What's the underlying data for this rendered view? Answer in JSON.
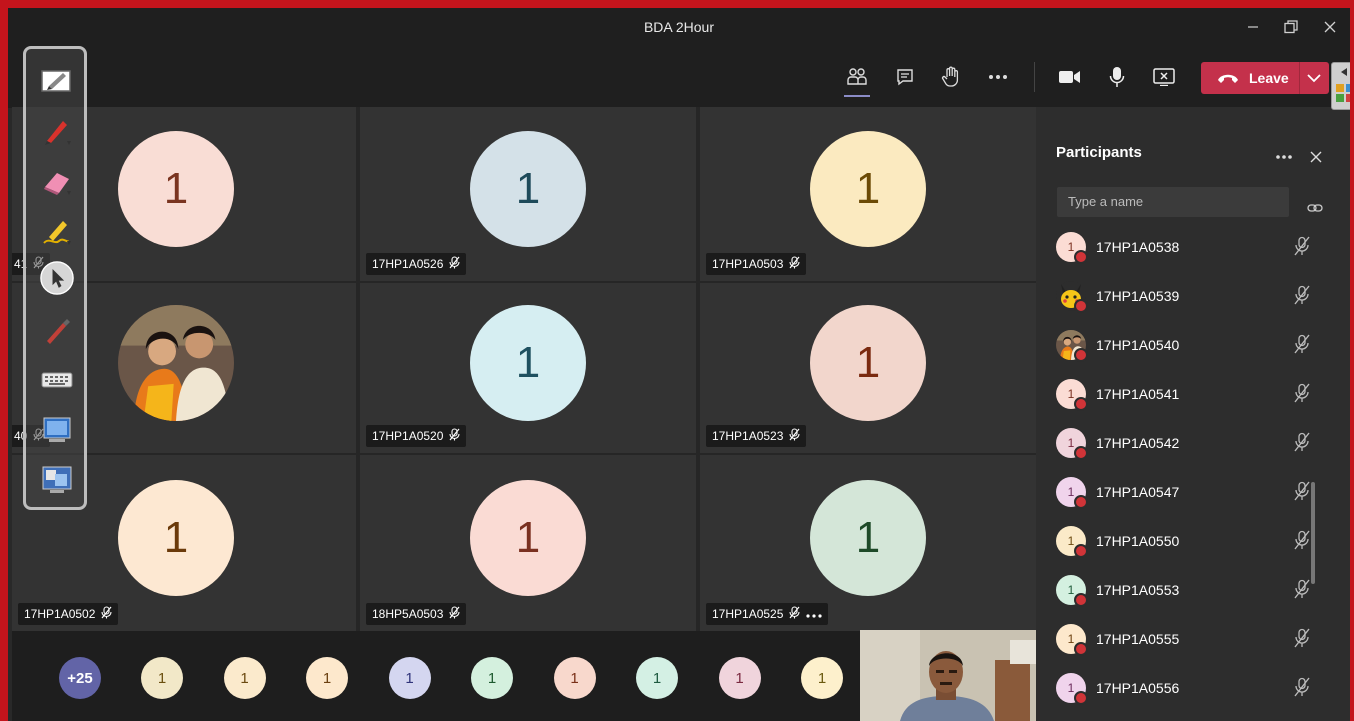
{
  "window": {
    "title": "BDA 2Hour"
  },
  "toolbar": {
    "leave_label": "Leave",
    "icons": [
      "people-icon",
      "chat-icon",
      "raise-hand-icon",
      "more-icon",
      "camera-icon",
      "mic-icon",
      "share-icon"
    ]
  },
  "tiles": [
    {
      "label": "17HP1A0541",
      "shown_label": "41",
      "avatar": "1",
      "bg": "#f9ddd5",
      "fg": "#7a3420"
    },
    {
      "label": "17HP1A0526",
      "avatar": "1",
      "bg": "#d4e1e8",
      "fg": "#1e4a5a"
    },
    {
      "label": "17HP1A0503",
      "avatar": "1",
      "bg": "#fbeac0",
      "fg": "#6b4a05"
    },
    {
      "label": "17HP1A0540",
      "shown_label": "40",
      "avatar": "photo",
      "bg": "#7a5a4a",
      "fg": "#fff"
    },
    {
      "label": "17HP1A0520",
      "avatar": "1",
      "bg": "#d6eef2",
      "fg": "#1e5060"
    },
    {
      "label": "17HP1A0523",
      "avatar": "1",
      "bg": "#f2d6cc",
      "fg": "#7a2a10"
    },
    {
      "label": "17HP1A0502",
      "avatar": "1",
      "bg": "#fde8d2",
      "fg": "#6b3a0a"
    },
    {
      "label": "18HP5A0503",
      "avatar": "1",
      "bg": "#fadbd4",
      "fg": "#7a3020"
    },
    {
      "label": "17HP1A0525",
      "avatar": "1",
      "bg": "#d4e6d8",
      "fg": "#1e4a28"
    }
  ],
  "overflow": {
    "count_label": "+25",
    "avatars": [
      {
        "text": "1",
        "bg": "#f2e8c8",
        "fg": "#6b5010"
      },
      {
        "text": "1",
        "bg": "#fbeacc",
        "fg": "#6b4a10"
      },
      {
        "text": "1",
        "bg": "#fde8cc",
        "fg": "#6b4010"
      },
      {
        "text": "1",
        "bg": "#d4d6f0",
        "fg": "#30347a"
      },
      {
        "text": "1",
        "bg": "#d4f0de",
        "fg": "#1e5a30"
      },
      {
        "text": "1",
        "bg": "#f8d8cc",
        "fg": "#7a3018"
      },
      {
        "text": "1",
        "bg": "#d4f0e4",
        "fg": "#1e5a40"
      },
      {
        "text": "1",
        "bg": "#f0d4dc",
        "fg": "#7a2a40"
      },
      {
        "text": "1",
        "bg": "#fdf0cc",
        "fg": "#6b5a10"
      }
    ]
  },
  "participants_panel": {
    "title": "Participants",
    "search_placeholder": "Type a name",
    "items": [
      {
        "name": "17HP1A0538",
        "avatar": "1",
        "bg": "#fbdcd4",
        "fg": "#7a3020"
      },
      {
        "name": "17HP1A0539",
        "avatar": "pikachu",
        "bg": "#f5c518",
        "fg": "#333"
      },
      {
        "name": "17HP1A0540",
        "avatar": "photo",
        "bg": "#8a6a50",
        "fg": "#fff"
      },
      {
        "name": "17HP1A0541",
        "avatar": "1",
        "bg": "#fbdcd4",
        "fg": "#7a3020"
      },
      {
        "name": "17HP1A0542",
        "avatar": "1",
        "bg": "#f0d4dc",
        "fg": "#7a2a40"
      },
      {
        "name": "17HP1A0547",
        "avatar": "1",
        "bg": "#f0d4ec",
        "fg": "#6a2a5a"
      },
      {
        "name": "17HP1A0550",
        "avatar": "1",
        "bg": "#fbeac8",
        "fg": "#6b4a10"
      },
      {
        "name": "17HP1A0553",
        "avatar": "1",
        "bg": "#d4f0e0",
        "fg": "#1e5a38"
      },
      {
        "name": "17HP1A0555",
        "avatar": "1",
        "bg": "#fde8cc",
        "fg": "#6b4010"
      },
      {
        "name": "17HP1A0556",
        "avatar": "1",
        "bg": "#f0d4ec",
        "fg": "#6a2a5a"
      }
    ]
  },
  "ink_tools": [
    "whiteboard-icon",
    "pen-icon",
    "eraser-icon",
    "highlighter-icon",
    "pointer-icon",
    "laser-pen-icon",
    "keyboard-icon",
    "screen-capture-icon",
    "desktop-icon"
  ]
}
